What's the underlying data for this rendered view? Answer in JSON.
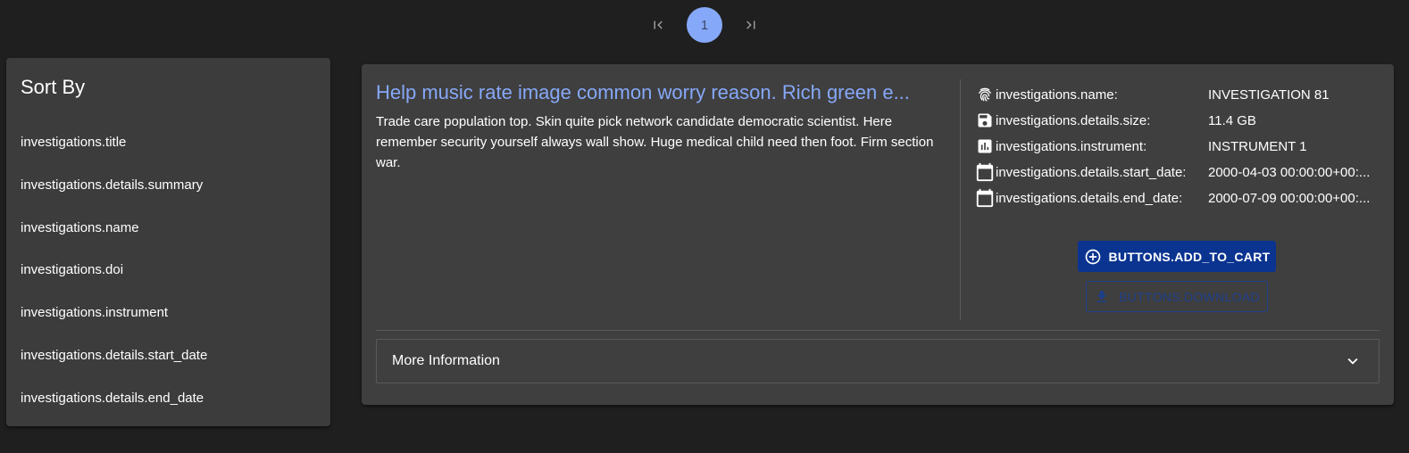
{
  "pagination": {
    "current_page": "1",
    "first_icon": "first-page-icon",
    "last_icon": "last-page-icon"
  },
  "sort": {
    "title": "Sort By",
    "items": [
      "investigations.title",
      "investigations.details.summary",
      "investigations.name",
      "investigations.doi",
      "investigations.instrument",
      "investigations.details.start_date",
      "investigations.details.end_date"
    ]
  },
  "card": {
    "title": "Help music rate image common worry reason. Rich green e...",
    "summary": "Trade care population top. Skin quite pick network candidate democratic scientist. Here remember security yourself always wall show. Huge medical child need then foot. Firm section war.",
    "details": [
      {
        "icon": "fingerprint-icon",
        "label": "investigations.name:",
        "value": "INVESTIGATION 81"
      },
      {
        "icon": "save-icon",
        "label": "investigations.details.size:",
        "value": "11.4 GB"
      },
      {
        "icon": "bar-chart-icon",
        "label": "investigations.instrument:",
        "value": "INSTRUMENT 1"
      },
      {
        "icon": "calendar-icon",
        "label": "investigations.details.start_date:",
        "value": "2000-04-03 00:00:00+00:..."
      },
      {
        "icon": "calendar-icon",
        "label": "investigations.details.end_date:",
        "value": "2000-07-09 00:00:00+00:..."
      }
    ],
    "add_to_cart_label": "BUTTONS.ADD_TO_CART",
    "download_label": "BUTTONS.DOWNLOAD",
    "more_info_label": "More Information"
  },
  "colors": {
    "background": "#1f1f1f",
    "panel": "#3c3c3c",
    "accent": "#86a8f8",
    "primary_button": "#0a3490"
  }
}
